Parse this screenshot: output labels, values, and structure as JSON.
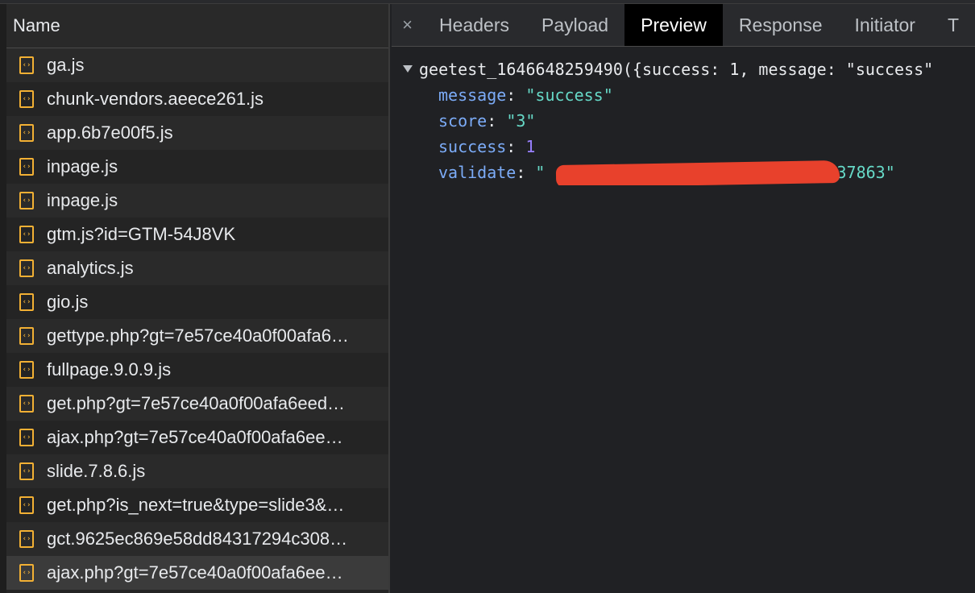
{
  "network": {
    "name_header": "Name",
    "requests": [
      {
        "name": "ga.js"
      },
      {
        "name": "chunk-vendors.aeece261.js"
      },
      {
        "name": "app.6b7e00f5.js"
      },
      {
        "name": "inpage.js"
      },
      {
        "name": "inpage.js"
      },
      {
        "name": "gtm.js?id=GTM-54J8VK"
      },
      {
        "name": "analytics.js"
      },
      {
        "name": "gio.js"
      },
      {
        "name": "gettype.php?gt=7e57ce40a0f00afa6…"
      },
      {
        "name": "fullpage.9.0.9.js"
      },
      {
        "name": "get.php?gt=7e57ce40a0f00afa6eed…"
      },
      {
        "name": "ajax.php?gt=7e57ce40a0f00afa6ee…"
      },
      {
        "name": "slide.7.8.6.js"
      },
      {
        "name": "get.php?is_next=true&type=slide3&…"
      },
      {
        "name": "gct.9625ec869e58dd84317294c308…"
      },
      {
        "name": "ajax.php?gt=7e57ce40a0f00afa6ee…",
        "selected": true
      }
    ],
    "icon": "script-file-icon",
    "icon_glyph": "‹›"
  },
  "tabs": {
    "close_glyph": "×",
    "items": [
      "Headers",
      "Payload",
      "Preview",
      "Response",
      "Initiator",
      "T"
    ],
    "active": "Preview"
  },
  "preview": {
    "root_text": "geetest_1646648259490({success: 1, message: \"success\"",
    "properties": {
      "message": {
        "key": "message",
        "value": "\"success\""
      },
      "score": {
        "key": "score",
        "value": "\"3\""
      },
      "success": {
        "key": "success",
        "value": "1"
      },
      "validate": {
        "key": "validate",
        "value_start": "\"",
        "value_end": "+37863\""
      }
    },
    "separator": ": "
  },
  "colors": {
    "accent_icon": "#f2b034",
    "key": "#7cacf8",
    "string": "#66d9c7",
    "number": "#9980ff",
    "redaction": "#e8412c"
  }
}
